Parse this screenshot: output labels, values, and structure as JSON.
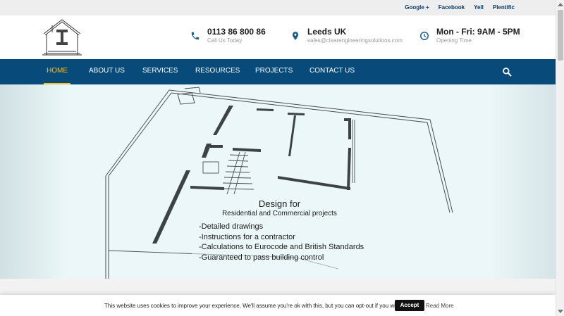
{
  "social": [
    "Google +",
    "Facebook",
    "Yell",
    "Plentific"
  ],
  "contact": {
    "phone": {
      "main": "0113 86 800 86",
      "sub": "Call Us Today",
      "icon": "phone-icon"
    },
    "location": {
      "main": "Leeds UK",
      "sub": "sales@clearengineeringsolutions.com",
      "icon": "map-pin-icon"
    },
    "hours": {
      "main": "Mon - Fri: 9AM - 5PM",
      "sub": "Opening Time",
      "icon": "clock-icon"
    }
  },
  "nav": [
    "HOME",
    "ABOUT US",
    "SERVICES",
    "RESOURCES",
    "PROJECTS",
    "CONTACT US"
  ],
  "nav_active": "HOME",
  "hero": {
    "title": "Design for",
    "subtitle": "Residential and Commercial projects",
    "bullets": [
      "-Detailed drawings",
      "-Instructions for a contractor",
      "-Calculations to Eurocode and British Standards",
      "-Guaranteed to pass building control"
    ]
  },
  "cookie": {
    "message": "This website uses cookies to improve your experience. We'll assume you're ok with this, but you can opt-out if you wish.",
    "accept": "Accept",
    "read_more": "Read More"
  },
  "colors": {
    "nav_bg": "#084a7a",
    "accent": "#f4c02b",
    "icon_blue": "#1b5e8f"
  }
}
